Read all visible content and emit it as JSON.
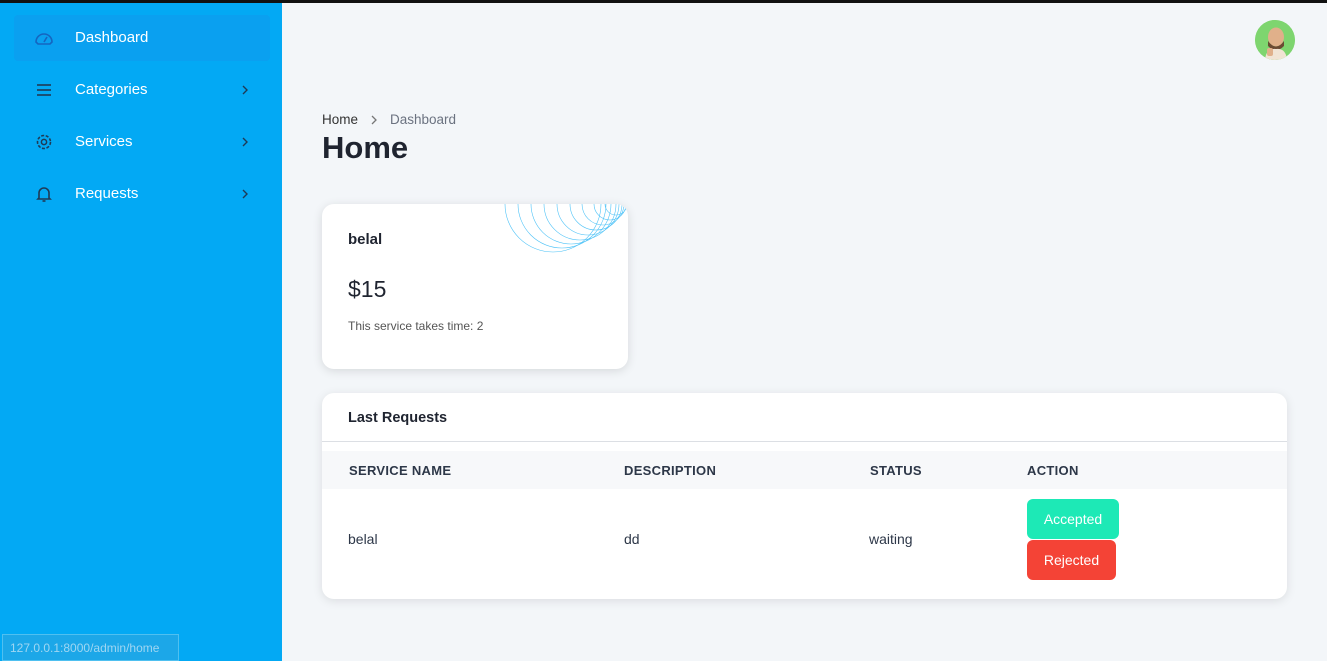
{
  "sidebar": {
    "items": [
      {
        "label": "Dashboard",
        "icon": "gauge-icon",
        "active": true
      },
      {
        "label": "Categories",
        "icon": "menu-icon"
      },
      {
        "label": "Services",
        "icon": "gear-icon"
      },
      {
        "label": "Requests",
        "icon": "bell-icon"
      }
    ]
  },
  "status_bar": {
    "url": "127.0.0.1:8000/admin/home"
  },
  "breadcrumb": {
    "home": "Home",
    "current": "Dashboard"
  },
  "page": {
    "title": "Home"
  },
  "service_card": {
    "name": "belal",
    "price": "$15",
    "time_text": "This service takes time: 2"
  },
  "requests": {
    "title": "Last Requests",
    "columns": [
      "SERVICE NAME",
      "DESCRIPTION",
      "STATUS",
      "ACTION"
    ],
    "rows": [
      {
        "service_name": "belal",
        "description": "dd",
        "status": "waiting",
        "accept_label": "Accepted",
        "reject_label": "Rejected"
      }
    ]
  },
  "colors": {
    "sidebar": "#03a9f4",
    "accept": "#1de9b6",
    "reject": "#f44336",
    "background": "#f3f6f9"
  }
}
